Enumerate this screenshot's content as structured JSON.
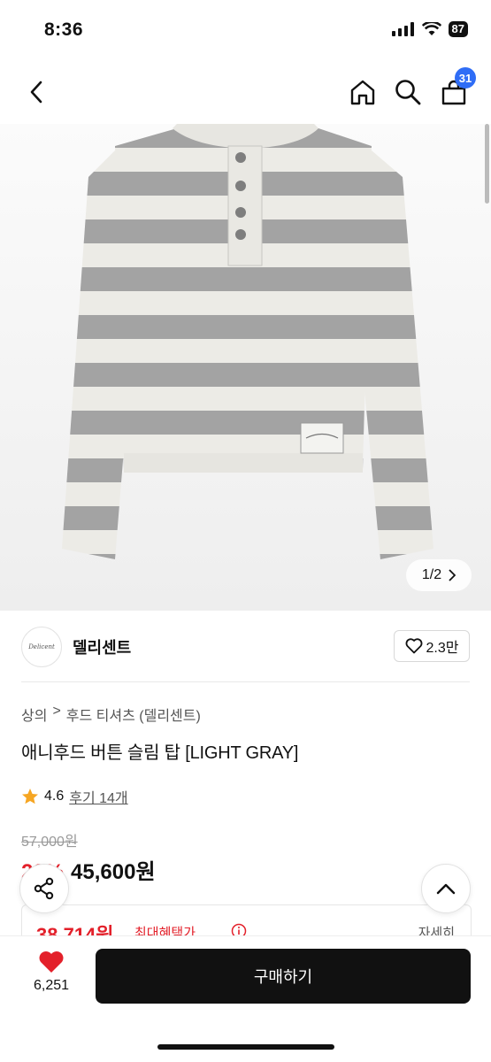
{
  "status_bar": {
    "time": "8:36",
    "battery": "87"
  },
  "nav": {
    "cart_count": "31"
  },
  "gallery": {
    "current": "1",
    "separator": "/",
    "total": "2"
  },
  "shop": {
    "name": "델리센트",
    "logo_text": "Delicent",
    "likes": "2.3만"
  },
  "breadcrumb": {
    "category": "상의",
    "sep": ">",
    "subcategory": "후드 티셔츠 (델리센트)"
  },
  "product": {
    "title": "애니후드 버튼 슬림 탑 [LIGHT GRAY]",
    "rating": "4.6",
    "reviews": "후기 14개",
    "original_price": "57,000원",
    "discount": "20%",
    "sale_price": "45,600원"
  },
  "benefit": {
    "price": "38,714원",
    "label": "최대혜택가",
    "detail": "자세히"
  },
  "bottom": {
    "wish_count": "6,251",
    "buy_label": "구매하기"
  },
  "colors": {
    "accent_red": "#e3202a",
    "badge_blue": "#2f6df6",
    "buy_button": "#111111"
  }
}
